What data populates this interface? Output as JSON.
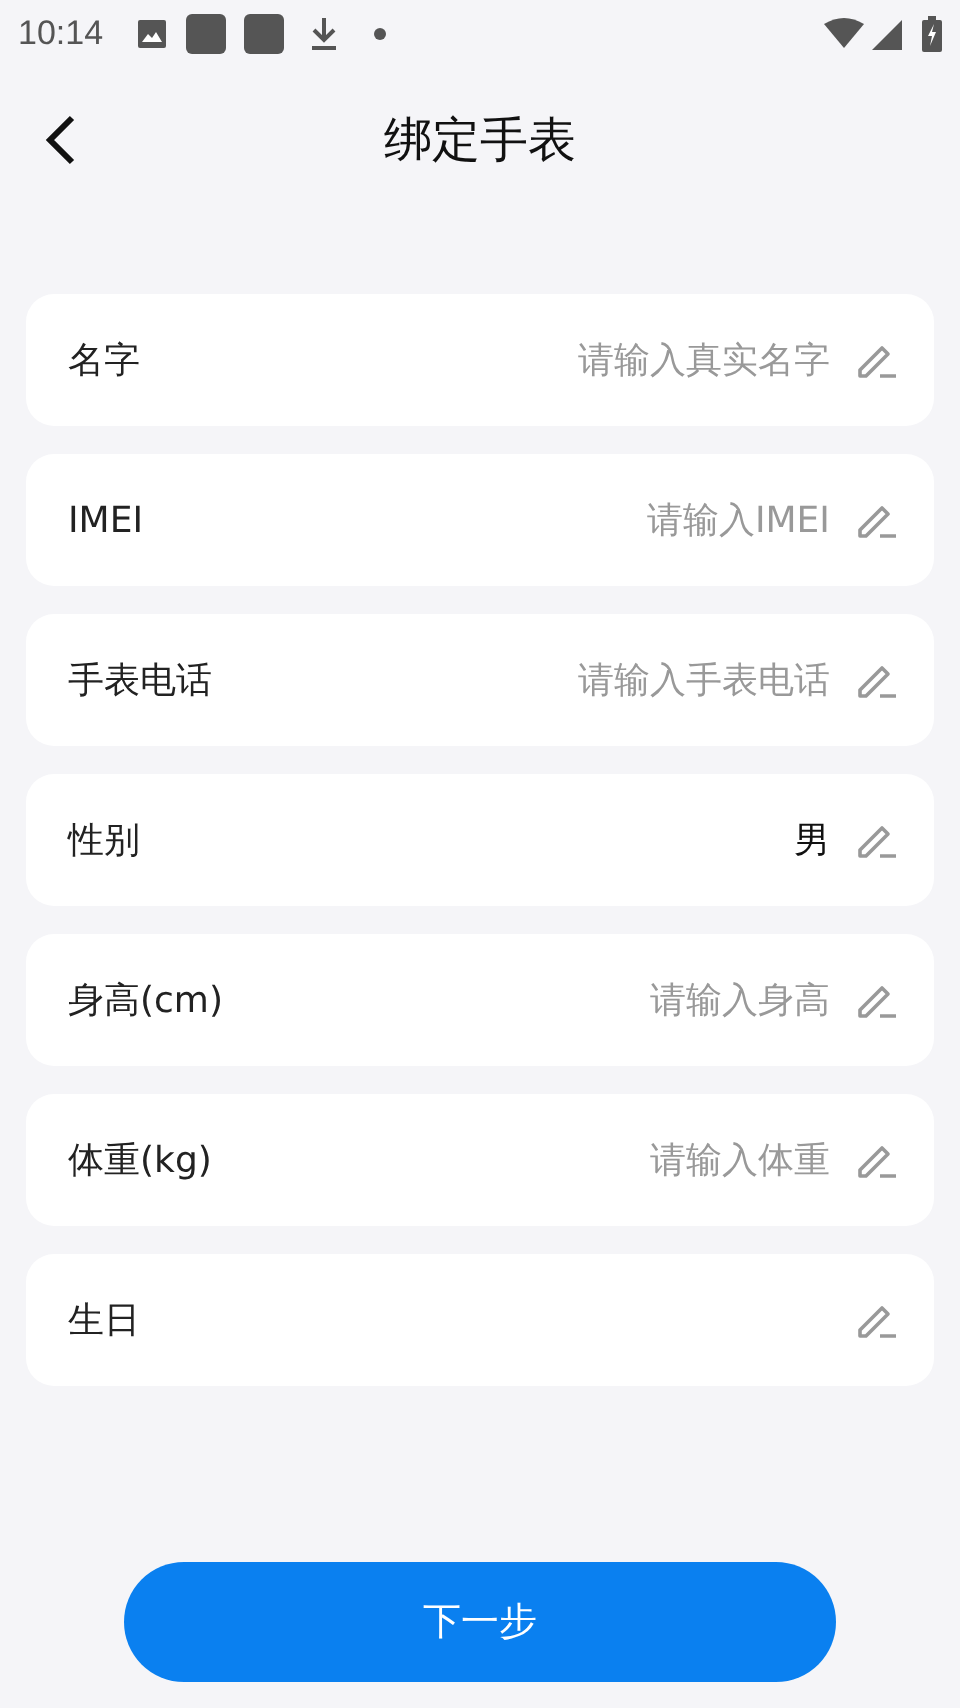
{
  "status_bar": {
    "time": "10:14"
  },
  "header": {
    "title": "绑定手表"
  },
  "fields": [
    {
      "label": "名字",
      "placeholder": "请输入真实名字"
    },
    {
      "label": "IMEI",
      "placeholder": "请输入IMEI"
    },
    {
      "label": "手表电话",
      "placeholder": "请输入手表电话"
    },
    {
      "label": "性别",
      "value": "男"
    },
    {
      "label": "身高(cm)",
      "placeholder": "请输入身高"
    },
    {
      "label": "体重(kg)",
      "placeholder": "请输入体重"
    },
    {
      "label": "生日"
    }
  ],
  "button": "下一步"
}
